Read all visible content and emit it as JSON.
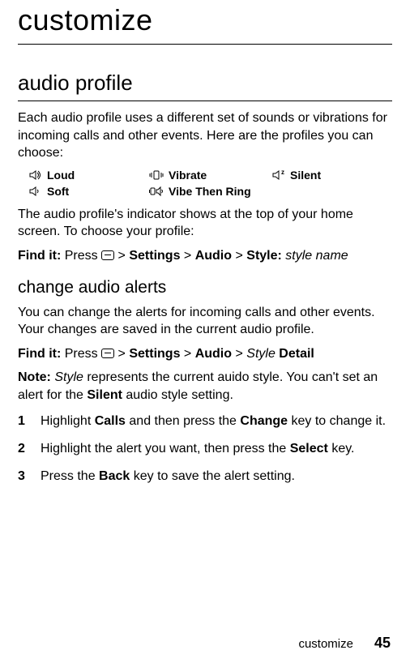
{
  "title": "customize",
  "section": {
    "heading": "audio profile",
    "intro": "Each audio profile uses a different set of sounds or vibrations for incoming calls and other events. Here are the profiles you can choose:"
  },
  "profiles": {
    "loud": "Loud",
    "vibrate": "Vibrate",
    "silent": "Silent",
    "soft": "Soft",
    "vibe_then_ring": "Vibe Then Ring"
  },
  "after_profiles": "The audio profile's indicator shows at the top of your home screen. To choose your profile:",
  "findit1": {
    "label": "Find it:",
    "lead": " Press ",
    "sep": " > ",
    "p1": "Settings",
    "p2": "Audio",
    "p3": "Style:",
    "p4": "style name"
  },
  "sub": {
    "heading": "change audio alerts",
    "body": "You can change the alerts for incoming calls and other events. Your changes are saved in the current audio profile."
  },
  "findit2": {
    "label": "Find it:",
    "lead": " Press ",
    "sep": " > ",
    "p1": "Settings",
    "p2": "Audio",
    "p3": "Style",
    "p4": "Detail"
  },
  "note": {
    "label": "Note:",
    "a": " Style",
    "b": " represents the current auido style. You can't set an alert for the ",
    "c": "Silent",
    "d": " audio style setting."
  },
  "steps": {
    "1": {
      "a": "Highlight ",
      "b": "Calls",
      "c": " and then press the ",
      "d": "Change",
      "e": " key to change it."
    },
    "2": {
      "a": "Highlight the alert you want, then press the ",
      "b": "Select",
      "c": " key."
    },
    "3": {
      "a": "Press the ",
      "b": "Back",
      "c": " key to save the alert setting."
    }
  },
  "footer": {
    "section": "customize",
    "page": "45"
  }
}
